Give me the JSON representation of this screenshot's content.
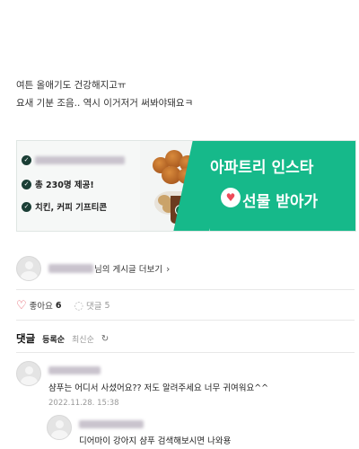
{
  "post": {
    "line1": "여튼 올애기도 건강해지고ㅠ",
    "line2": "요새 기분 조음.. 역시 이거저거 써봐야돼요ㅋ"
  },
  "banner": {
    "feature_2": "총 230명 제공!",
    "feature_3": "치킨, 커피 기프티콘",
    "title": "아파트리 인스타",
    "subtitle": "선물 받아가",
    "accent_color": "#16b98a"
  },
  "author": {
    "link_label": "님의 게시글 더보기",
    "chevron_icon": "chevron-right-icon"
  },
  "actions": {
    "like_label": "좋아요",
    "like_count": "6",
    "comment_label": "댓글",
    "comment_count": "5",
    "like_icon": "heart-outline-icon",
    "comment_icon": "speech-bubble-icon"
  },
  "comments": {
    "title": "댓글",
    "sort_active": "등록순",
    "sort_inactive": "최신순",
    "refresh_icon": "refresh-icon",
    "items": [
      {
        "text": "샴푸는 어디서 사셨어요?? 저도 알려주세요 너무 귀여워요^^",
        "date": "2022.11.28. 15:38"
      },
      {
        "text": "디어마이 강아지 샴푸 검색해보시면 나와용"
      }
    ]
  }
}
